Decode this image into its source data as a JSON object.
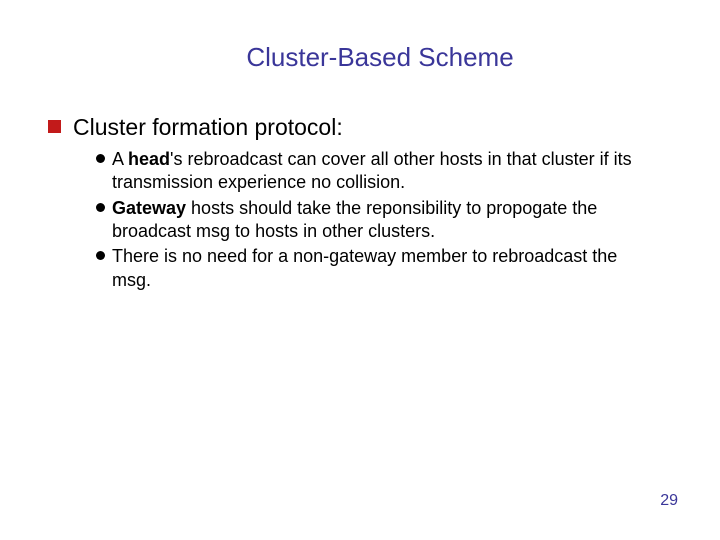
{
  "title": "Cluster-Based Scheme",
  "level1_text": "Cluster formation protocol:",
  "bullets": [
    {
      "pre": "A ",
      "bold": "head",
      "post": "'s rebroadcast can cover all other hosts in that cluster if its transmission experience no collision."
    },
    {
      "pre": "",
      "bold": "Gateway",
      "post": " hosts should take the reponsibility to propogate the broadcast msg to hosts in other clusters."
    },
    {
      "pre": "",
      "bold": "",
      "post": "There is no need for a non-gateway member to rebroadcast the msg."
    }
  ],
  "page_number": "29"
}
